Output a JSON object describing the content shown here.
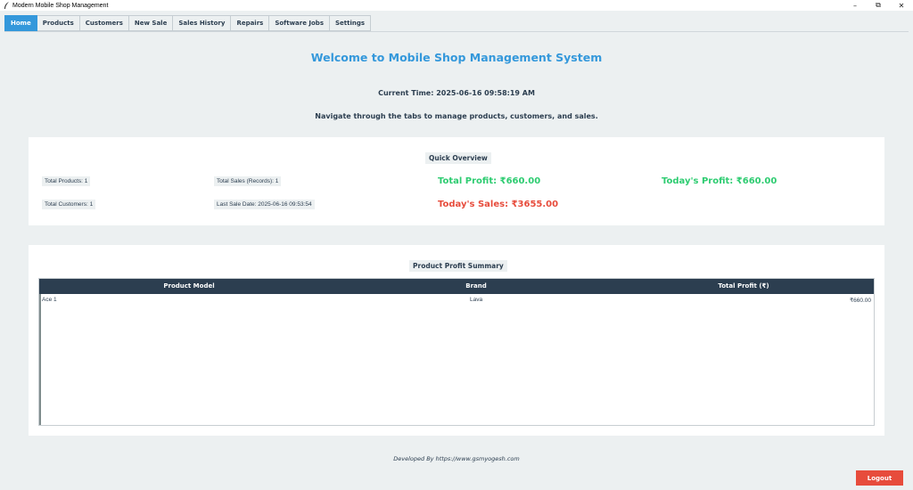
{
  "window": {
    "title": "Modern Mobile Shop Management",
    "controls": {
      "minimize": "–",
      "maximize": "⧉",
      "close": "✕"
    }
  },
  "tabs": [
    {
      "label": "Home",
      "active": true
    },
    {
      "label": "Products"
    },
    {
      "label": "Customers"
    },
    {
      "label": "New Sale"
    },
    {
      "label": "Sales History"
    },
    {
      "label": "Repairs"
    },
    {
      "label": "Software Jobs"
    },
    {
      "label": "Settings"
    }
  ],
  "home": {
    "welcome": "Welcome to Mobile Shop Management System",
    "current_time": "Current Time: 2025-06-16 09:58:19 AM",
    "nav_hint": "Navigate through the tabs to manage products, customers, and sales."
  },
  "overview": {
    "title": "Quick Overview",
    "total_products": "Total Products: 1",
    "total_sales": "Total Sales (Records): 1",
    "total_profit": "Total Profit: ₹660.00",
    "todays_profit": "Today's Profit: ₹660.00",
    "total_customers": "Total Customers: 1",
    "last_sale": "Last Sale Date: 2025-06-16 09:53:54",
    "todays_sales": "Today's Sales: ₹3655.00"
  },
  "profit_summary": {
    "title": "Product Profit Summary",
    "columns": [
      "Product Model",
      "Brand",
      "Total Profit (₹)"
    ],
    "rows": [
      {
        "model": "Ace 1",
        "brand": "Lava",
        "profit": "₹660.00"
      }
    ]
  },
  "footer": {
    "credit": "Developed By https://www.gsmyogesh.com"
  },
  "logout_label": "Logout",
  "colors": {
    "accent": "#3498db",
    "header_dark": "#2c3e50",
    "profit_green": "#2ecc71",
    "sales_red": "#e74c3c",
    "background": "#ecf0f1"
  }
}
